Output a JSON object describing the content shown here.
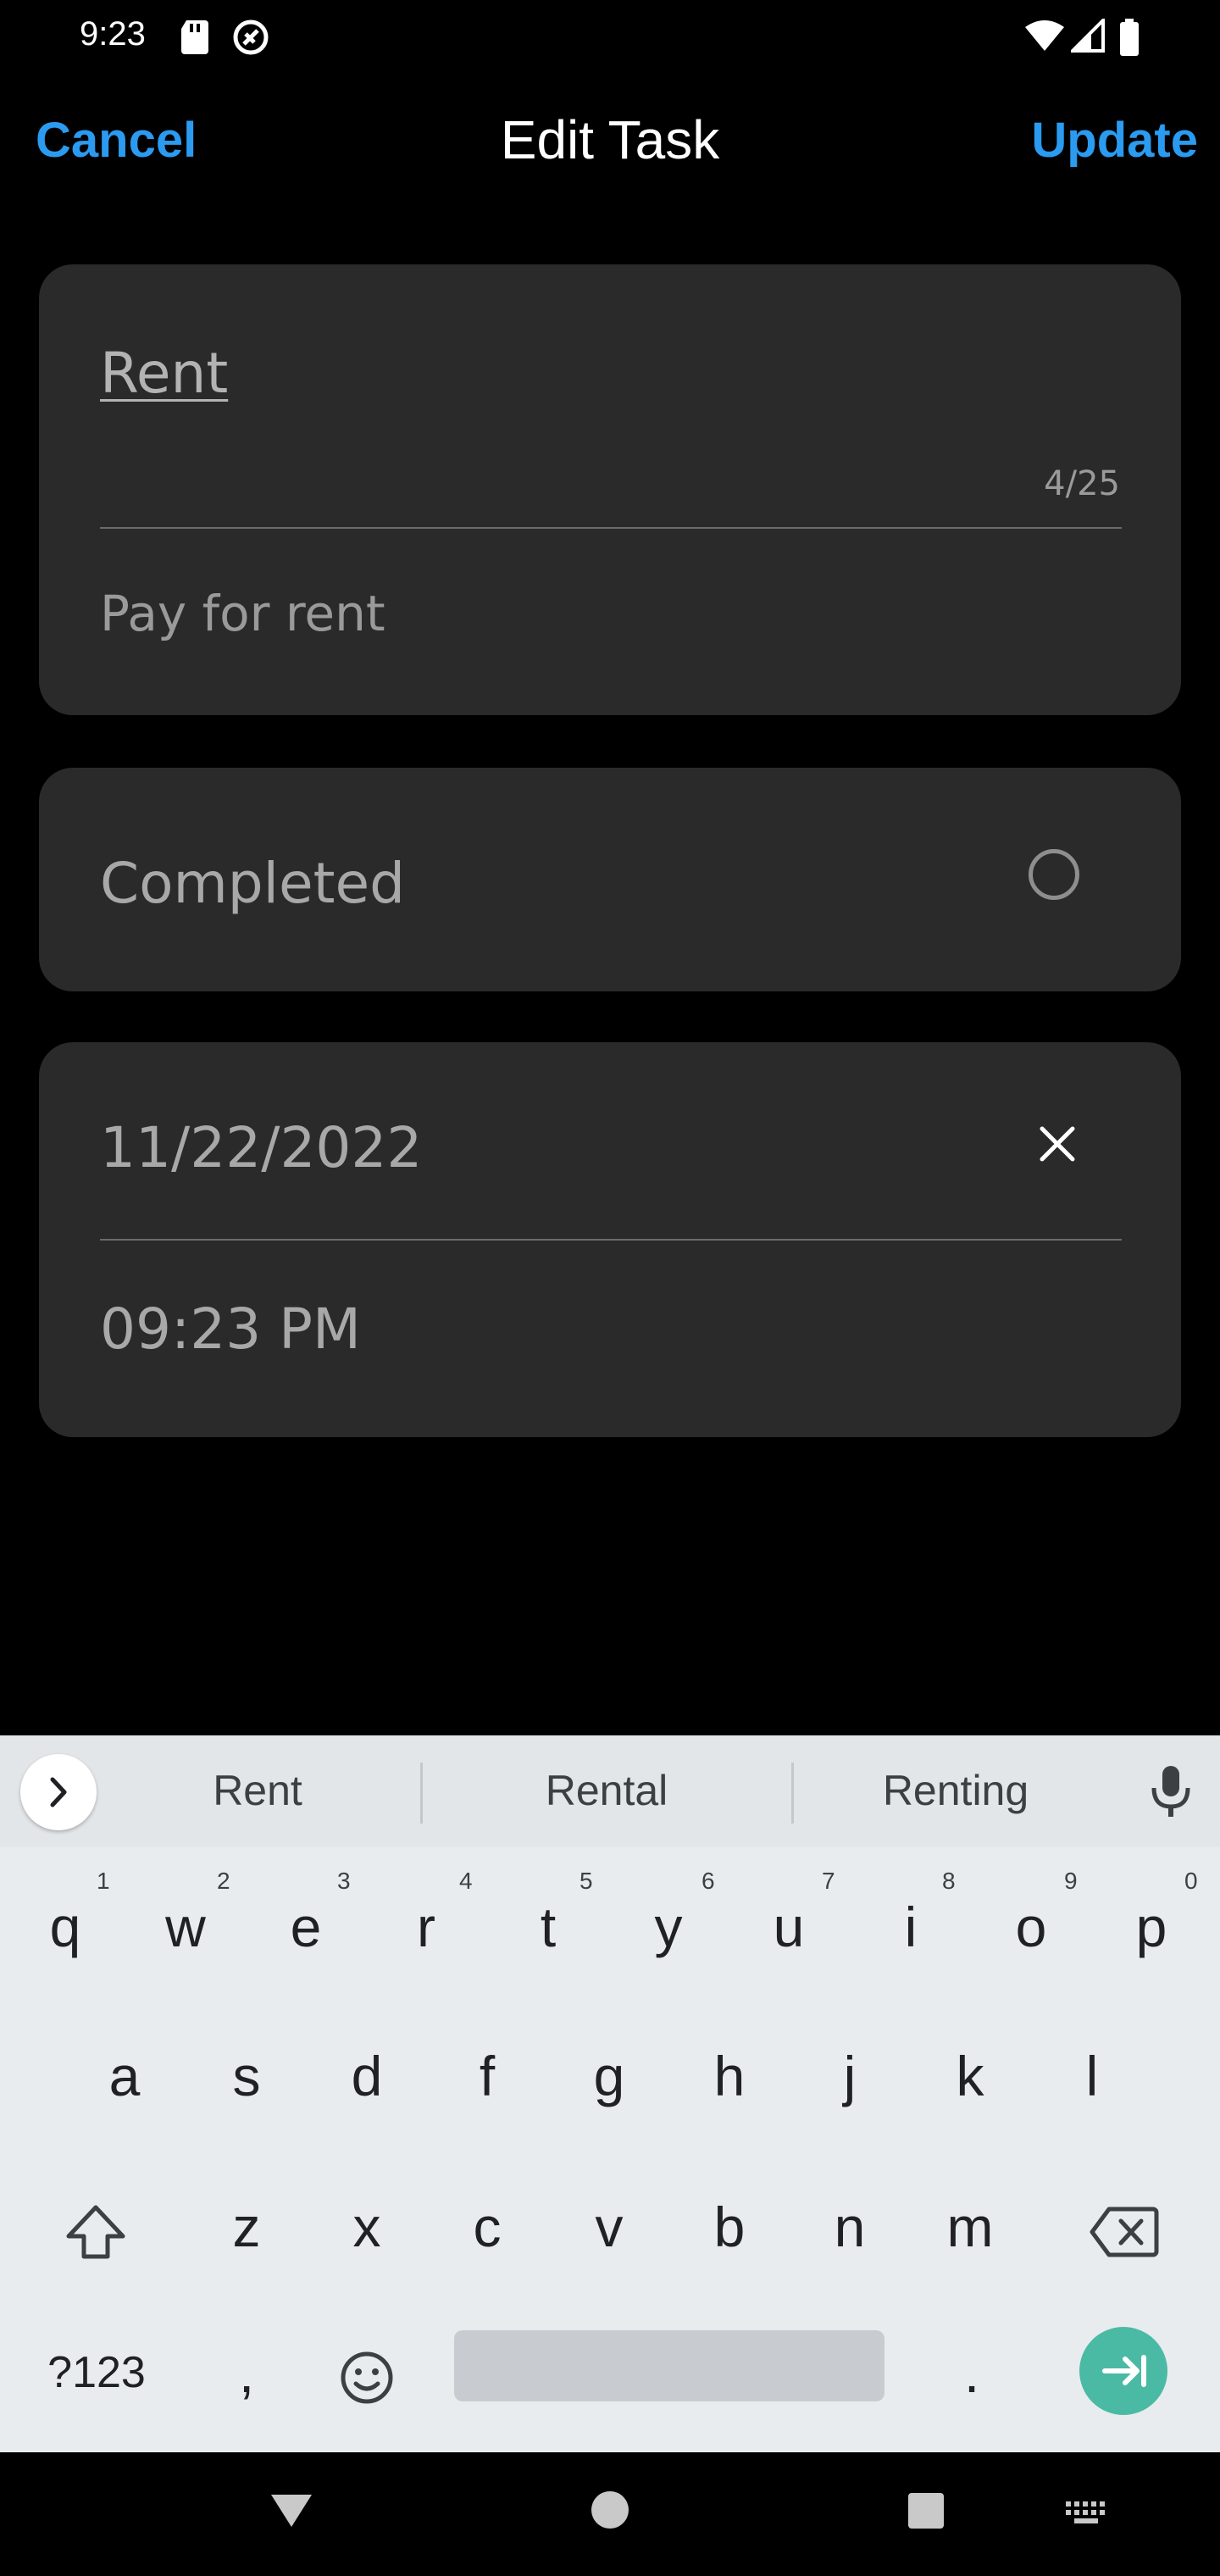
{
  "status_bar": {
    "time": "9:23"
  },
  "header": {
    "cancel_label": "Cancel",
    "title": "Edit Task",
    "update_label": "Update"
  },
  "task": {
    "name": "Rent",
    "name_counter": "4/25",
    "description_placeholder": "Pay for rent",
    "completed_label": "Completed",
    "completed": false,
    "date": "11/22/2022",
    "time": "09:23 PM"
  },
  "keyboard": {
    "suggestions": [
      "Rent",
      "Rental",
      "Renting"
    ],
    "row1": [
      "q",
      "w",
      "e",
      "r",
      "t",
      "y",
      "u",
      "i",
      "o",
      "p"
    ],
    "row1_hints": [
      "1",
      "2",
      "3",
      "4",
      "5",
      "6",
      "7",
      "8",
      "9",
      "0"
    ],
    "row2": [
      "a",
      "s",
      "d",
      "f",
      "g",
      "h",
      "j",
      "k",
      "l"
    ],
    "row3": [
      "z",
      "x",
      "c",
      "v",
      "b",
      "n",
      "m"
    ],
    "symbols_key": "?123",
    "comma_key": ",",
    "period_key": "."
  },
  "colors": {
    "accent": "#2a9bf0",
    "card": "#2a2a2a",
    "enter_key": "#4bbaa4"
  }
}
